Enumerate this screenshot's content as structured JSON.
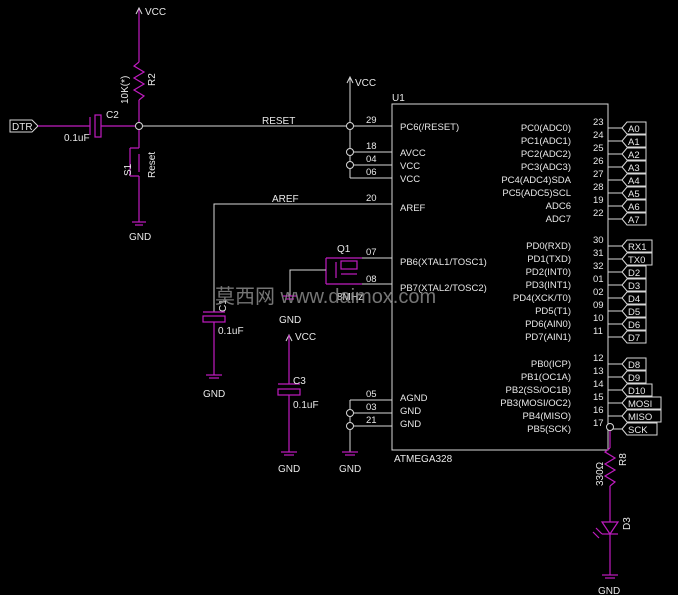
{
  "power": {
    "vcc": "VCC",
    "gnd": "GND"
  },
  "u1": {
    "ref": "U1",
    "part": "ATMEGA328",
    "pins_left": [
      {
        "num": "29",
        "name": "PC6(/RESET)"
      },
      {
        "num": "18",
        "name": "AVCC"
      },
      {
        "num": "04",
        "name": "VCC"
      },
      {
        "num": "06",
        "name": "VCC"
      },
      {
        "num": "20",
        "name": "AREF"
      },
      {
        "num": "07",
        "name": "PB6(XTAL1/TOSC1)"
      },
      {
        "num": "08",
        "name": "PB7(XTAL2/TOSC2)"
      },
      {
        "num": "05",
        "name": "AGND"
      },
      {
        "num": "03",
        "name": "GND"
      },
      {
        "num": "21",
        "name": "GND"
      }
    ],
    "pins_right": [
      {
        "num": "23",
        "name": "PC0(ADC0)",
        "net": "A0"
      },
      {
        "num": "24",
        "name": "PC1(ADC1)",
        "net": "A1"
      },
      {
        "num": "25",
        "name": "PC2(ADC2)",
        "net": "A2"
      },
      {
        "num": "26",
        "name": "PC3(ADC3)",
        "net": "A3"
      },
      {
        "num": "27",
        "name": "PC4(ADC4)SDA",
        "net": "A4"
      },
      {
        "num": "28",
        "name": "PC5(ADC5)SCL",
        "net": "A5"
      },
      {
        "num": "19",
        "name": "ADC6",
        "net": "A6"
      },
      {
        "num": "22",
        "name": "ADC7",
        "net": "A7"
      },
      {
        "num": "30",
        "name": "PD0(RXD)",
        "net": "RX1"
      },
      {
        "num": "31",
        "name": "PD1(TXD)",
        "net": "TX0"
      },
      {
        "num": "32",
        "name": "PD2(INT0)",
        "net": "D2"
      },
      {
        "num": "01",
        "name": "PD3(INT1)",
        "net": "D3"
      },
      {
        "num": "02",
        "name": "PD4(XCK/T0)",
        "net": "D4"
      },
      {
        "num": "09",
        "name": "PD5(T1)",
        "net": "D5"
      },
      {
        "num": "10",
        "name": "PD6(AIN0)",
        "net": "D6"
      },
      {
        "num": "11",
        "name": "PD7(AIN1)",
        "net": "D7"
      },
      {
        "num": "12",
        "name": "PB0(ICP)",
        "net": "D8"
      },
      {
        "num": "13",
        "name": "PB1(OC1A)",
        "net": "D9"
      },
      {
        "num": "14",
        "name": "PB2(SS/OC1B)",
        "net": "D10"
      },
      {
        "num": "15",
        "name": "PB3(MOSI/OC2)",
        "net": "MOSI"
      },
      {
        "num": "16",
        "name": "PB4(MISO)",
        "net": "MISO"
      },
      {
        "num": "17",
        "name": "PB5(SCK)",
        "net": "SCK"
      }
    ]
  },
  "nets": {
    "dtr": "DTR",
    "reset": "RESET",
    "aref": "AREF"
  },
  "parts": {
    "r2_ref": "R2",
    "r2_val": "10K(*)",
    "c2_ref": "C2",
    "c2_val": "0.1uF",
    "s1_ref": "S1",
    "s1_val": "Reset",
    "c_aref_val": "0.1uF",
    "q1_ref": "Q1",
    "q1_val": "8MHz",
    "c3_ref": "C3",
    "c3_val": "0.1uF",
    "r8_ref": "R8",
    "r8_val": "330Ω",
    "d3_ref": "D3"
  },
  "watermark": "莫西网 www.daimox.com"
}
